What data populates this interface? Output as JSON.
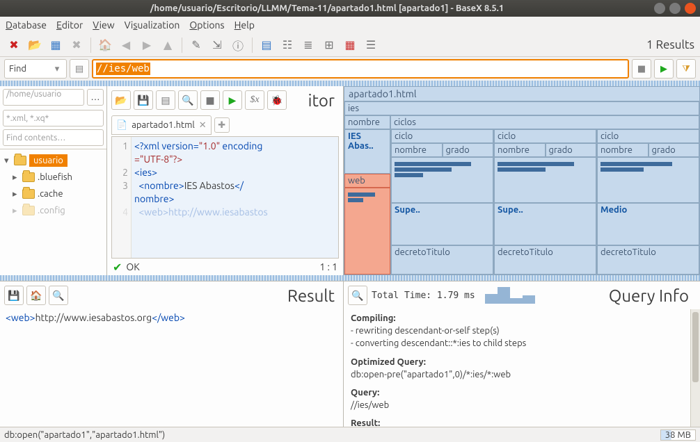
{
  "window": {
    "title": "/home/usuario/Escritorio/LLMM/Tema-11/apartado1.html [apartado1] - BaseX 8.5.1"
  },
  "menubar": {
    "database": "Database",
    "editor": "Editor",
    "view": "View",
    "visualization": "Visualization",
    "options": "Options",
    "help": "Help"
  },
  "toolbar": {
    "results": "1 Results"
  },
  "querybar": {
    "find": "Find",
    "query": "//ies/web"
  },
  "project": {
    "path": "/home/usuario",
    "filter": "*.xml, *.xq*",
    "find": "Find contents…",
    "tree": {
      "sel": "usuario",
      "a": ".bluefish",
      "b": ".cache",
      "c": ".config"
    }
  },
  "editor": {
    "title": "itor",
    "tab": "apartado1.html",
    "code": {
      "l1a": "<?xml version=",
      "l1b": "\"1.0\"",
      "l1c": " encoding",
      "l1d": "=\"UTF-8\"?>",
      "l2": "<ies>",
      "l3a": "  <nombre>",
      "l3b": "IES Abastos",
      "l3c": "</nombre>",
      "l4": "  <web>http://www.iesabastos"
    },
    "status_ok": "OK",
    "cursor": "1 : 1"
  },
  "treemap": {
    "root": "apartado1.html",
    "ies": "ies",
    "nombre": "nombre",
    "nombre_val": "IES Abas..",
    "web": "web",
    "ciclos": "ciclos",
    "ciclo": "ciclo",
    "grado": "grado",
    "grado_sup": "Supe..",
    "grado_med": "Medio",
    "decreto": "decretoTitulo"
  },
  "result": {
    "title": "Result",
    "line_open": "<web>",
    "line_text": "http://www.iesabastos.org",
    "line_close": "</web>"
  },
  "queryinfo": {
    "title": "Query Info",
    "total": "Total Time: 1.79 ms",
    "compiling_h": "Compiling:",
    "compiling_1": "- rewriting descendant-or-self step(s)",
    "compiling_2": "- converting descendant::*:ies to child steps",
    "optq_h": "Optimized Query:",
    "optq": "db:open-pre(\"apartado1\",0)/*:ies/*:web",
    "query_h": "Query:",
    "query": "//ies/web",
    "result_h": "Result:"
  },
  "statusbar": {
    "left": "db:open(\"apartado1\",\"apartado1.html\")",
    "mem": "38 MB"
  }
}
